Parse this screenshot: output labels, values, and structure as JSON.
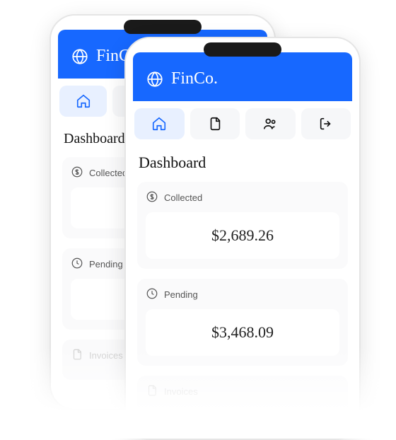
{
  "brand": "FinCo.",
  "page_title": "Dashboard",
  "nav": {
    "home": "home",
    "documents": "documents",
    "people": "people",
    "logout": "logout"
  },
  "cards": {
    "collected": {
      "label": "Collected",
      "value": "$2,689.26"
    },
    "pending": {
      "label": "Pending",
      "value": "$3,468.09"
    },
    "invoices": {
      "label": "Invoices",
      "value": ""
    }
  },
  "colors": {
    "brand": "#1768ff",
    "nav_active_bg": "#e8f0ff",
    "nav_bg": "#f6f7f9"
  }
}
